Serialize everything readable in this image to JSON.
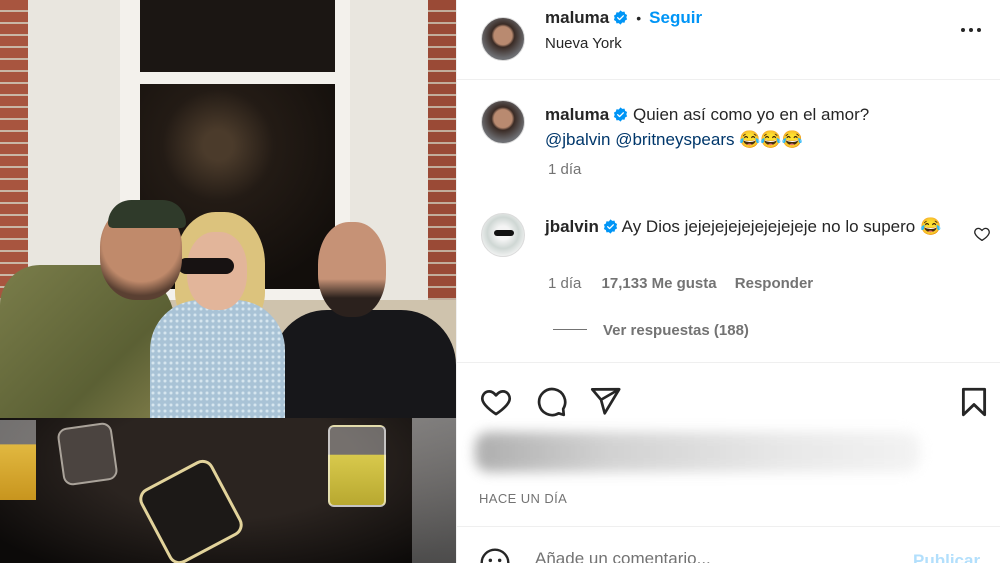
{
  "post": {
    "author": "maluma",
    "follow_label": "Seguir",
    "location": "Nueva York",
    "separator": "•"
  },
  "caption": {
    "author": "maluma",
    "text": "Quien así como yo en el amor?",
    "mention1": "@jbalvin",
    "mention2": "@britneyspears",
    "emoji": "😂😂😂",
    "time": "1 día"
  },
  "comment": {
    "author": "jbalvin",
    "text": "Ay Dios jejejejejejejejejeje no lo supero 😂",
    "time": "1 día",
    "likes": "17,133 Me gusta",
    "reply_label": "Responder",
    "view_replies": "Ver respuestas (188)"
  },
  "footer": {
    "timeago": "HACE UN DÍA",
    "comment_placeholder": "Añade un comentario...",
    "publish_label": "Publicar"
  },
  "icons": {
    "verified": "verified-badge-icon",
    "more": "more-options-icon",
    "like": "heart-icon",
    "comment": "comment-bubble-icon",
    "share": "paper-plane-icon",
    "save": "bookmark-icon",
    "emoji": "smiley-icon"
  },
  "colors": {
    "accent": "#0095f6",
    "mention": "#00376b",
    "muted": "#737373",
    "publish_disabled": "#b2dffc"
  }
}
